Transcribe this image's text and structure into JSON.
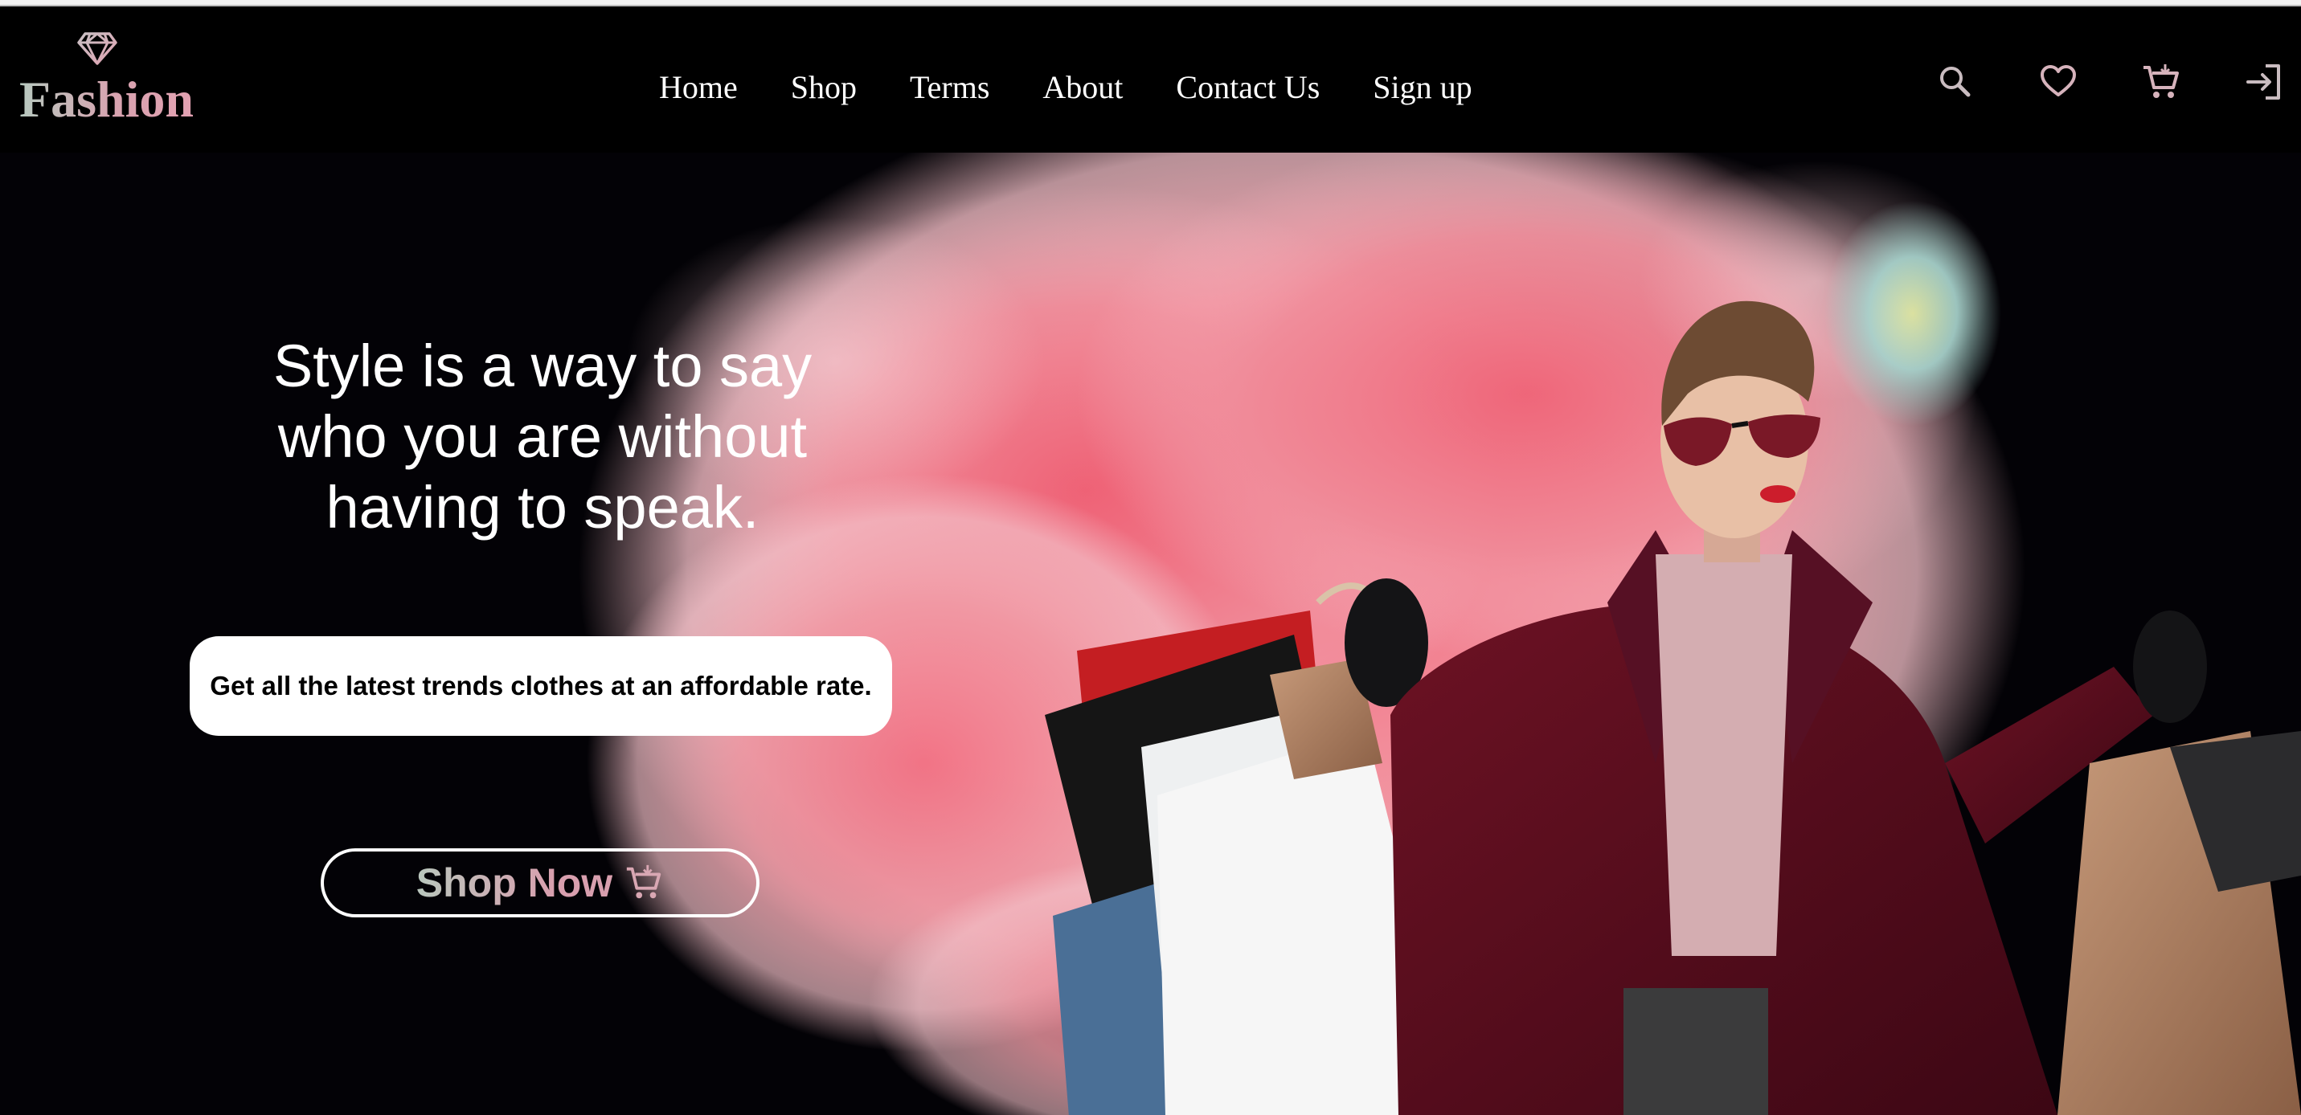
{
  "brand": {
    "name": "Fashion",
    "icon": "diamond-icon"
  },
  "nav": {
    "items": [
      {
        "label": "Home"
      },
      {
        "label": "Shop"
      },
      {
        "label": "Terms"
      },
      {
        "label": "About"
      },
      {
        "label": "Contact Us"
      },
      {
        "label": "Sign up"
      }
    ]
  },
  "header_icons": [
    "search-icon",
    "heart-icon",
    "cart-icon",
    "login-icon"
  ],
  "hero": {
    "headline_lines": [
      "Style is a way to say",
      "who you are without",
      "having to speak."
    ],
    "subtext": "Get all the latest trends clothes at an affordable rate.",
    "cta_label": "Shop Now",
    "cta_icon": "cart-icon"
  },
  "colors": {
    "background": "#000000",
    "text": "#ffffff",
    "brand_gradient_start": "#b7c9bf",
    "brand_gradient_end": "#e2a1b1",
    "smoke_pink": "#f28b98",
    "coat": "#5a0c1c"
  }
}
